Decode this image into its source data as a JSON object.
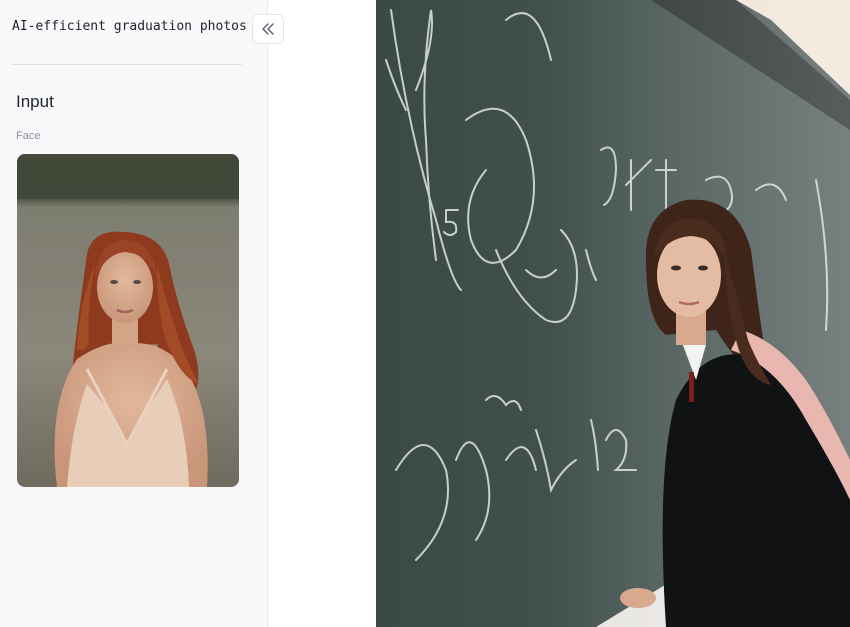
{
  "app": {
    "title": "AI-efficient graduation photos"
  },
  "sidebar": {
    "collapse_icon": "double-chevron-left-icon",
    "section_title": "Input",
    "face_label": "Face",
    "face_image_description": "Portrait of a red-haired woman in a light dress sitting outdoors"
  },
  "result": {
    "image_description": "Young woman in black graduation gown with pink stole, leaning against a chalkboard with white scribbles"
  },
  "colors": {
    "sidebar_bg": "#f8f9fb",
    "chalkboard": "#2f3f3b",
    "chalk": "#dfe6e2"
  }
}
